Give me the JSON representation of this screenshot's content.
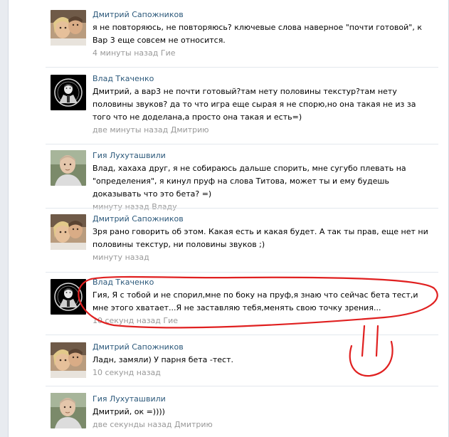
{
  "comments": [
    {
      "author": "Дмитрий Сапожников",
      "avatar": "couple-photo",
      "text": "я не повторяюсь, не повторяюсь? ключевые слова наверное \"почти готовой\", к Вар 3 еще совсем не относится.",
      "time": "4 минуты назад",
      "reply_to": "Гие"
    },
    {
      "author": "Влад Ткаченко",
      "avatar": "anonymous-mask",
      "text": "Дмитрий, а вар3 не почти готовый?там нету половины текстур?там нету половины звуков? да то что игра еще сырая я не спорю,но она такая не из за того что не доделана,а просто она такая и есть=)",
      "time": "две минуты назад",
      "reply_to": "Дмитрию"
    },
    {
      "author": "Гия Лухуташвили",
      "avatar": "man-photo",
      "text": "Влад, хахаха друг, я не собираюсь дальше спорить, мне сугубо плевать на \"определения\", я кинул пруф на слова Титова, может ты и ему будешь доказывать что это бета? =)",
      "time": "минуту назад",
      "reply_to": "Владу"
    },
    {
      "author": "Дмитрий Сапожников",
      "avatar": "couple-photo",
      "text": "Зря рано говорить об этом. Какая есть и какая будет. А так ты прав, еще нет ни половины текстур, ни половины звуков ;)",
      "time": "минуту назад",
      "reply_to": ""
    },
    {
      "author": "Влад Ткаченко",
      "avatar": "anonymous-mask",
      "text": "Гия, Я с тобой и не спорил,мне по боку на пруф,я знаю что сейчас бета тест,и мне этого хватает...Я не заставляю тебя,менять свою точку зрения...",
      "time": "10 секунд назад",
      "reply_to": "Гие"
    },
    {
      "author": "Дмитрий Сапожников",
      "avatar": "couple-photo",
      "text": "Ладн, замяли) У парня бета -тест.",
      "time": "10 секунд назад",
      "reply_to": ""
    },
    {
      "author": "Гия Лухуташвили",
      "avatar": "man-photo",
      "text": "Дмитрий, ок =))))",
      "time": "две секунды назад",
      "reply_to": "Дмитрию"
    }
  ],
  "colors": {
    "author_link": "#2b587a",
    "meta_text": "#999999",
    "annotation_red": "#e02020"
  }
}
